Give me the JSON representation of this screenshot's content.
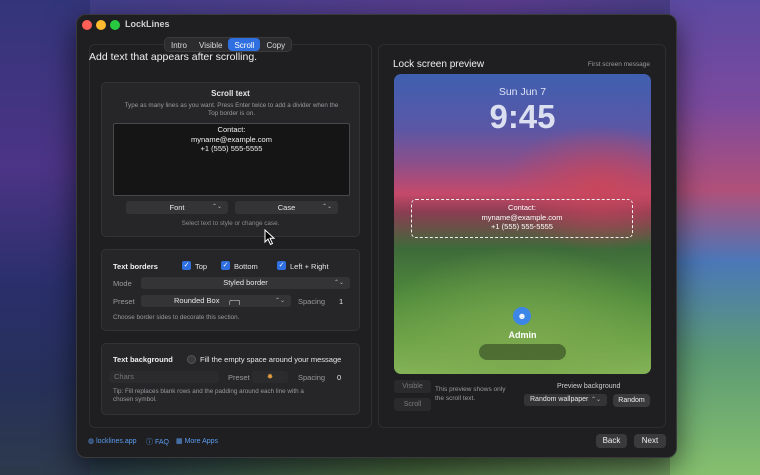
{
  "window": {
    "title": "LockLines"
  },
  "tabs": [
    "Intro",
    "Visible",
    "Scroll",
    "Copy"
  ],
  "active_tab": "Scroll",
  "left": {
    "heading": "Add text that appears after scrolling.",
    "scroll_text": {
      "title": "Scroll text",
      "subtitle_line1": "Type as many lines as you want. Press Enter twice to add a divider when the",
      "subtitle_line2": "Top border is on.",
      "lines": [
        "Contact:",
        "myname@example.com",
        "+1 (555) 555-5555"
      ],
      "font_label": "Font",
      "case_label": "Case",
      "hint": "Select text to style or change case."
    },
    "borders": {
      "title": "Text borders",
      "top": "Top",
      "bottom": "Bottom",
      "left_right": "Left + Right",
      "mode_label": "Mode",
      "mode_value": "Styled border",
      "preset_label": "Preset",
      "preset_value": "Rounded Box",
      "spacing_label": "Spacing",
      "spacing_value": "1",
      "hint": "Choose border sides to decorate this section."
    },
    "background": {
      "title": "Text background",
      "fill_label": "Fill the empty space around your message",
      "chars_placeholder": "Chars",
      "preset_label": "Preset",
      "spacing_label": "Spacing",
      "spacing_value": "0",
      "hint_line1": "Tip: Fill replaces blank rows and the padding around each line with a",
      "hint_line2": "chosen symbol."
    }
  },
  "footer": {
    "site": "locklines.app",
    "faq": "FAQ",
    "more_apps": "More Apps",
    "back": "Back",
    "next": "Next"
  },
  "right": {
    "title": "Lock screen preview",
    "note": "First screen message",
    "preview": {
      "date": "Sun Jun 7",
      "time": "9:45",
      "lines": [
        "Contact:",
        "myname@example.com",
        "+1 (555) 555-5555"
      ],
      "user": "Admin"
    },
    "visible_btn": "Visible",
    "scroll_btn": "Scroll",
    "desc_line1": "This preview shows only",
    "desc_line2": "the scroll text.",
    "bg_label": "Preview background",
    "bg_value": "Random wallpaper",
    "random_btn": "Random"
  },
  "colors": {
    "accent": "#2f6fe0",
    "window_bg": "#1f1f21",
    "link": "#5b9cf0"
  }
}
